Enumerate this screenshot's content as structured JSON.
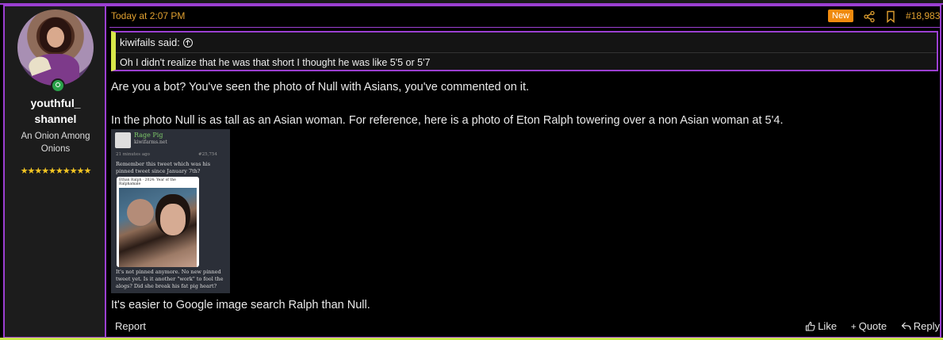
{
  "user": {
    "username_line1": "youthful_",
    "username_line2": "shannel",
    "title": "An Onion Among Onions",
    "stars": "★★★★★★★★★★"
  },
  "post": {
    "timestamp": "Today at 2:07 PM",
    "badge": "New",
    "number": "#18,983",
    "quote": {
      "author": "kiwifails said:",
      "text": "Oh I didn't realize that he was that short I thought he was like 5'5 or 5'7"
    },
    "paragraph1": "Are you a bot? You've seen the photo of Null with Asians, you've commented on it.",
    "paragraph2": "In the photo Null is as tall as an Asian woman. For reference, here is a photo of Eton Ralph towering over a non Asian woman at 5'4.",
    "paragraph3": "It's easier to Google image search Ralph than Null.",
    "embed": {
      "name": "Rage Pig",
      "site": "kiwifarms.net",
      "time": "21 minutes ago",
      "post_id": "#25,754",
      "text_top": "Remember this tweet which was his pinned tweet since January 7th?",
      "tweet_header": "Ethan Ralph · 2024: Year of the Ralphamale",
      "text_bottom": "It's not pinned anymore. No new pinned tweet yet. Is it another \"work\" to fool the alogs? Did she break his fat pig heart?"
    }
  },
  "footer": {
    "report": "Report",
    "like": "Like",
    "quote": "Quote",
    "reply": "Reply"
  },
  "colors": {
    "accent": "#9b3fd1",
    "timestamp": "#e0a030",
    "badge": "#f08a0e",
    "online": "#2aa14a",
    "quote_bar": "#d8e84a"
  }
}
